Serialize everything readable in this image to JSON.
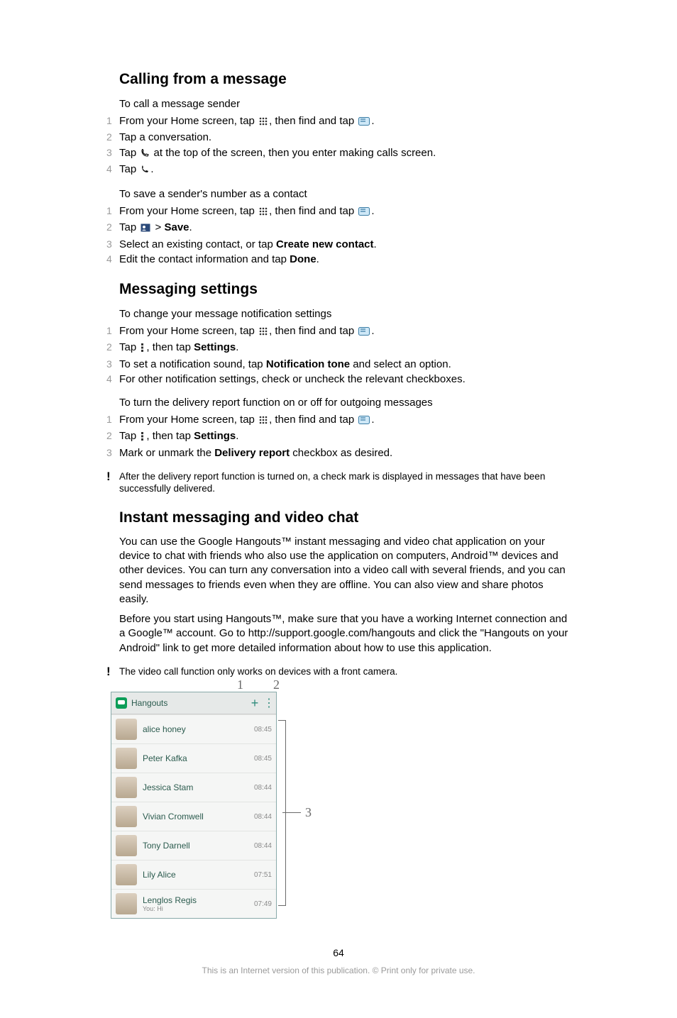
{
  "section1": {
    "title": "Calling from a message",
    "sub1": "To call a message sender",
    "steps1": [
      {
        "n": "1",
        "pre": "From your Home screen, tap ",
        "mid": ", then find and tap ",
        "post": "."
      },
      {
        "n": "2",
        "text": "Tap a conversation."
      },
      {
        "n": "3",
        "pre": "Tap ",
        "post": " at the top of the screen, then you enter making calls screen."
      },
      {
        "n": "4",
        "pre": "Tap ",
        "post": "."
      }
    ],
    "sub2": "To save a sender's number as a contact",
    "steps2": [
      {
        "n": "1",
        "pre": "From your Home screen, tap ",
        "mid": ", then find and tap ",
        "post": "."
      },
      {
        "n": "2",
        "pre": "Tap ",
        "mid": " > ",
        "bold": "Save",
        "post": "."
      },
      {
        "n": "3",
        "pre": "Select an existing contact, or tap ",
        "bold": "Create new contact",
        "post": "."
      },
      {
        "n": "4",
        "pre": "Edit the contact information and tap ",
        "bold": "Done",
        "post": "."
      }
    ]
  },
  "section2": {
    "title": "Messaging settings",
    "sub1": "To change your message notification settings",
    "steps1": [
      {
        "n": "1",
        "pre": "From your Home screen, tap ",
        "mid": ", then find and tap ",
        "post": "."
      },
      {
        "n": "2",
        "pre": "Tap ",
        "mid": ", then tap ",
        "bold": "Settings",
        "post": "."
      },
      {
        "n": "3",
        "pre": "To set a notification sound, tap ",
        "bold": "Notification tone",
        "post": " and select an option."
      },
      {
        "n": "4",
        "text": "For other notification settings, check or uncheck the relevant checkboxes."
      }
    ],
    "sub2": "To turn the delivery report function on or off for outgoing messages",
    "steps2": [
      {
        "n": "1",
        "pre": "From your Home screen, tap ",
        "mid": ", then find and tap ",
        "post": "."
      },
      {
        "n": "2",
        "pre": "Tap ",
        "mid": ", then tap ",
        "bold": "Settings",
        "post": "."
      },
      {
        "n": "3",
        "pre": "Mark or unmark the ",
        "bold": "Delivery report",
        "post": " checkbox as desired."
      }
    ],
    "note": "After the delivery report function is turned on, a check mark is displayed in messages that have been successfully delivered."
  },
  "section3": {
    "title": "Instant messaging and video chat",
    "para1": "You can use the Google Hangouts™ instant messaging and video chat application on your device to chat with friends who also use the application on computers, Android™ devices and other devices. You can turn any conversation into a video call with several friends, and you can send messages to friends even when they are offline. You can also view and share photos easily.",
    "para2": "Before you start using Hangouts™, make sure that you have a working Internet connection and a Google™ account. Go to http://support.google.com/hangouts and click the \"Hangouts on your Android\" link to get more detailed information about how to use this application.",
    "note": "The video call function only works on devices with a front camera."
  },
  "hangouts": {
    "title": "Hangouts",
    "rows": [
      {
        "name": "alice honey",
        "time": "08:45"
      },
      {
        "name": "Peter Kafka",
        "time": "08:45"
      },
      {
        "name": "Jessica Stam",
        "time": "08:44"
      },
      {
        "name": "Vivian Cromwell",
        "time": "08:44"
      },
      {
        "name": "Tony Darnell",
        "time": "08:44"
      },
      {
        "name": "Lily Alice",
        "time": "07:51"
      },
      {
        "name": "Lenglos Regis",
        "sub": "You: Hi",
        "time": "07:49"
      }
    ]
  },
  "callouts": {
    "c1": "1",
    "c2": "2",
    "c3": "3"
  },
  "pagenum": "64",
  "footer": "This is an Internet version of this publication. © Print only for private use."
}
